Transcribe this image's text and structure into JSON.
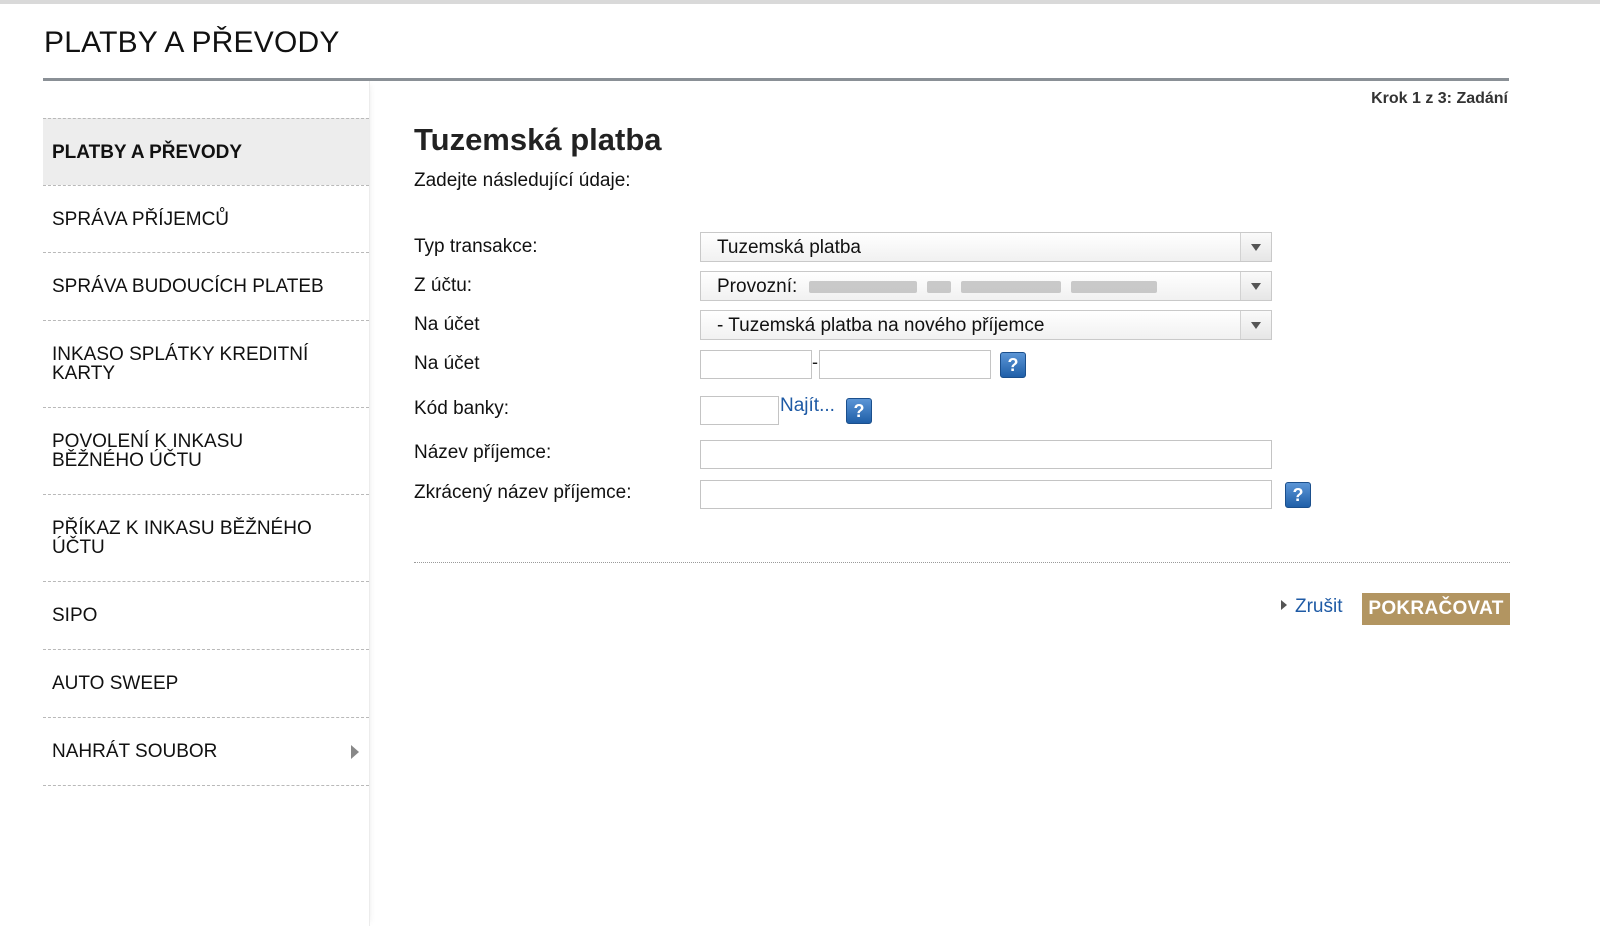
{
  "header": {
    "title": "PLATBY A PŘEVODY"
  },
  "sidebar": {
    "items": [
      {
        "label": "PLATBY A PŘEVODY",
        "active": true
      },
      {
        "label": "SPRÁVA PŘÍJEMCŮ"
      },
      {
        "label": "SPRÁVA BUDOUCÍCH PLATEB"
      },
      {
        "label": "INKASO SPLÁTKY KREDITNÍ KARTY"
      },
      {
        "label": "POVOLENÍ K INKASU BĚŽNÉHO ÚČTU"
      },
      {
        "label": "PŘÍKAZ K INKASU BĚŽNÉHO ÚČTU"
      },
      {
        "label": "SIPO"
      },
      {
        "label": "AUTO SWEEP"
      },
      {
        "label": "NAHRÁT SOUBOR",
        "has_submenu": true
      }
    ]
  },
  "main": {
    "step": "Krok 1 z 3: Zadání",
    "heading": "Tuzemská platba",
    "subheading": "Zadejte následující údaje:",
    "form": {
      "typ_transakce": {
        "label": "Typ transakce:",
        "value": "Tuzemská platba"
      },
      "z_uctu": {
        "label": "Z účtu:",
        "value": "Provozní:"
      },
      "na_ucet_select": {
        "label": "Na účet",
        "value": "- Tuzemská platba na nového příjemce"
      },
      "na_ucet_number": {
        "label": "Na účet",
        "separator": "-",
        "prefix_value": "",
        "number_value": ""
      },
      "kod_banky": {
        "label": "Kód banky:",
        "value": "",
        "find_link": "Najít..."
      },
      "nazev_prijemce": {
        "label": "Název příjemce:",
        "value": ""
      },
      "zkraceny_nazev": {
        "label": "Zkrácený název příjemce:",
        "value": ""
      },
      "help_glyph": "?"
    },
    "actions": {
      "cancel": "Zrušit",
      "continue": "POKRAČOVAT"
    }
  },
  "colors": {
    "accent_button": "#b29561",
    "link": "#1e5aa5",
    "help_icon": "#2a6ab5"
  }
}
